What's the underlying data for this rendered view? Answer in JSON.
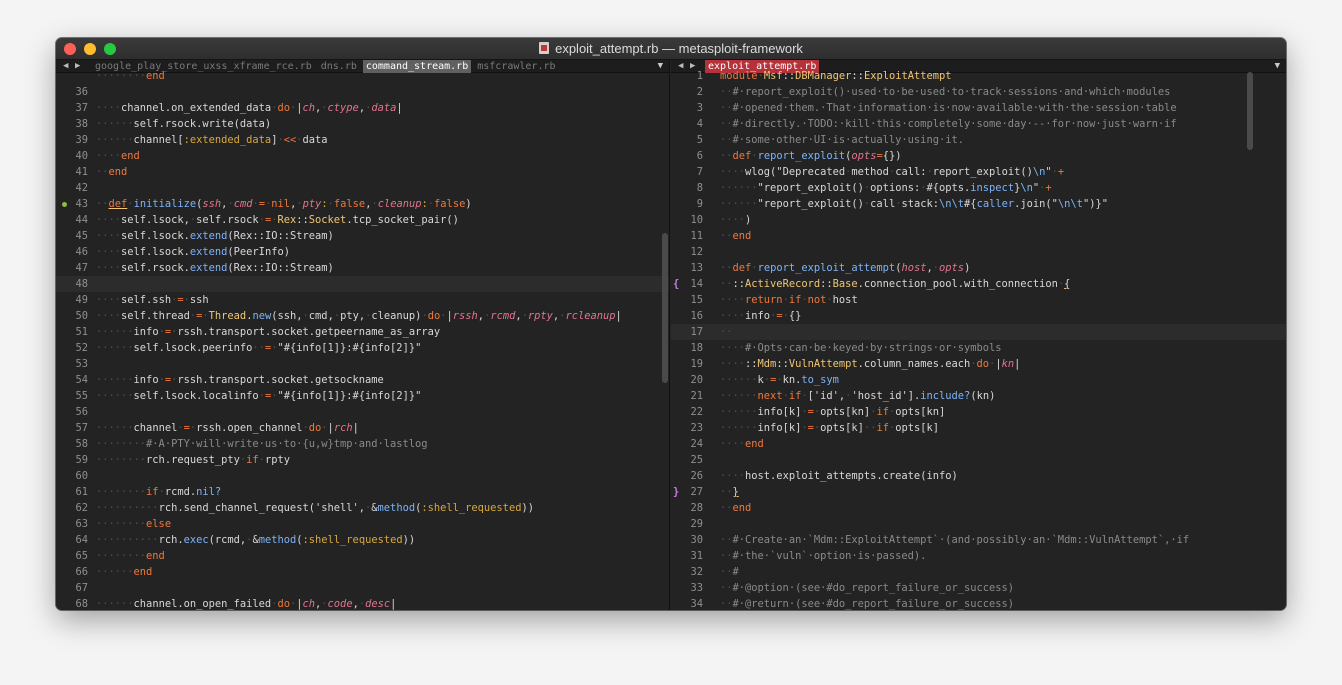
{
  "window": {
    "title": "exploit_attempt.rb — metasploit-framework"
  },
  "left_tabs": [
    {
      "label": "google_play_store_uxss_xframe_rce.rb",
      "active": false
    },
    {
      "label": "dns.rb",
      "active": false
    },
    {
      "label": "command_stream.rb",
      "active": true
    },
    {
      "label": "msfcrawler.rb",
      "active": false
    }
  ],
  "right_tabs": [
    {
      "label": "exploit_attempt.rb",
      "active": true
    }
  ],
  "nav": {
    "back": "◀",
    "forward": "▶",
    "dropdown": "▼"
  },
  "colors": {
    "keyword": "#f0783c",
    "method": "#7eb3f7",
    "argument": "#e3748f",
    "symbol": "#d8a840",
    "comment": "#8a8a8a",
    "active_tab_right": "#b5323a",
    "bracket_marker": "#c57ee0"
  },
  "left_code": [
    {
      "n": "",
      "html": "<span class='ws'>········</span><span class='kw'>end</span>"
    },
    {
      "n": "36",
      "html": ""
    },
    {
      "n": "37",
      "html": "<span class='ws'>····</span>channel.on_extended_data<span class='ws'>·</span><span class='kw'>do</span><span class='ws'>·</span>|<span class='at'>ch</span>,<span class='ws'>·</span><span class='at'>ctype</span>,<span class='ws'>·</span><span class='at'>data</span>|"
    },
    {
      "n": "38",
      "html": "<span class='ws'>······</span>self.rsock.write(data)"
    },
    {
      "n": "39",
      "html": "<span class='ws'>······</span>channel[<span class='sy'>:extended_data</span>]<span class='ws'>·</span><span class='kw'>&lt;&lt;</span><span class='ws'>·</span>data"
    },
    {
      "n": "40",
      "html": "<span class='ws'>····</span><span class='kw'>end</span>"
    },
    {
      "n": "41",
      "html": "<span class='ws'>··</span><span class='kw'>end</span>"
    },
    {
      "n": "42",
      "html": ""
    },
    {
      "n": "43",
      "dot": true,
      "html": "<span class='ws'>··</span><span class='kw und'>def</span><span class='ws'>·</span><span class='fn'>initialize</span>(<span class='at'>ssh</span>,<span class='ws'>·</span><span class='at'>cmd</span><span class='ws'>·</span><span class='kw'>=</span><span class='ws'>·</span><span class='kw'>nil</span>,<span class='ws'>·</span><span class='at'>pty</span><span class='sy'>:</span><span class='ws'>·</span><span class='kw'>false</span>,<span class='ws'>·</span><span class='at'>cleanup</span><span class='sy'>:</span><span class='ws'>·</span><span class='kw'>false</span>)"
    },
    {
      "n": "44",
      "html": "<span class='ws'>····</span>self.lsock,<span class='ws'>·</span>self.rsock<span class='ws'>·</span><span class='kw'>=</span><span class='ws'>·</span><span class='cy'>Rex</span>::<span class='cy'>Socket</span>.tcp_socket_pair()"
    },
    {
      "n": "45",
      "html": "<span class='ws'>····</span>self.lsock.<span class='mb'>extend</span>(Rex::IO::Stream)"
    },
    {
      "n": "46",
      "html": "<span class='ws'>····</span>self.lsock.<span class='mb'>extend</span>(PeerInfo)"
    },
    {
      "n": "47",
      "html": "<span class='ws'>····</span>self.rsock.<span class='mb'>extend</span>(Rex::IO::Stream)"
    },
    {
      "n": "48",
      "cur": true,
      "html": ""
    },
    {
      "n": "49",
      "html": "<span class='ws'>····</span>self.ssh<span class='ws'>·</span><span class='kw'>=</span><span class='ws'>·</span>ssh"
    },
    {
      "n": "50",
      "html": "<span class='ws'>····</span>self.thread<span class='ws'>·</span><span class='kw'>=</span><span class='ws'>·</span><span class='cy'>Thread</span>.<span class='mb'>new</span>(ssh,<span class='ws'>·</span>cmd,<span class='ws'>·</span>pty,<span class='ws'>·</span>cleanup)<span class='ws'>·</span><span class='kw'>do</span><span class='ws'>·</span>|<span class='at'>rssh</span>,<span class='ws'>·</span><span class='at'>rcmd</span>,<span class='ws'>·</span><span class='at'>rpty</span>,<span class='ws'>·</span><span class='at'>rcleanup</span>|"
    },
    {
      "n": "51",
      "html": "<span class='ws'>······</span>info<span class='ws'>·</span><span class='kw'>=</span><span class='ws'>·</span>rssh.transport.socket.getpeername_as_array"
    },
    {
      "n": "52",
      "html": "<span class='ws'>······</span>self.lsock.peerinfo<span class='ws'>··</span><span class='kw'>=</span><span class='ws'>·</span>\"#{info[1]}:#{info[2]}\""
    },
    {
      "n": "53",
      "html": ""
    },
    {
      "n": "54",
      "html": "<span class='ws'>······</span>info<span class='ws'>·</span><span class='kw'>=</span><span class='ws'>·</span>rssh.transport.socket.getsockname"
    },
    {
      "n": "55",
      "html": "<span class='ws'>······</span>self.lsock.localinfo<span class='ws'>·</span><span class='kw'>=</span><span class='ws'>·</span>\"#{info[1]}:#{info[2]}\""
    },
    {
      "n": "56",
      "html": ""
    },
    {
      "n": "57",
      "html": "<span class='ws'>······</span>channel<span class='ws'>·</span><span class='kw'>=</span><span class='ws'>·</span>rssh.open_channel<span class='ws'>·</span><span class='kw'>do</span><span class='ws'>·</span>|<span class='at'>rch</span>|"
    },
    {
      "n": "58",
      "html": "<span class='ws'>········</span><span class='cm'>#·A·PTY·will·write·us·to·{u,w}tmp·and·lastlog</span>"
    },
    {
      "n": "59",
      "html": "<span class='ws'>········</span>rch.request_pty<span class='ws'>·</span><span class='kw'>if</span><span class='ws'>·</span>rpty"
    },
    {
      "n": "60",
      "html": ""
    },
    {
      "n": "61",
      "html": "<span class='ws'>········</span><span class='kw'>if</span><span class='ws'>·</span>rcmd.<span class='mb'>nil?</span>"
    },
    {
      "n": "62",
      "html": "<span class='ws'>··········</span>rch.send_channel_request('shell',<span class='ws'>·</span>&amp;<span class='mb'>method</span>(<span class='sy'>:shell_requested</span>))"
    },
    {
      "n": "63",
      "html": "<span class='ws'>········</span><span class='kw'>else</span>"
    },
    {
      "n": "64",
      "html": "<span class='ws'>··········</span>rch.<span class='mb'>exec</span>(rcmd,<span class='ws'>·</span>&amp;<span class='mb'>method</span>(<span class='sy'>:shell_requested</span>))"
    },
    {
      "n": "65",
      "html": "<span class='ws'>········</span><span class='kw'>end</span>"
    },
    {
      "n": "66",
      "html": "<span class='ws'>······</span><span class='kw'>end</span>"
    },
    {
      "n": "67",
      "html": ""
    },
    {
      "n": "68",
      "html": "<span class='ws'>······</span>channel.on_open_failed<span class='ws'>·</span><span class='kw'>do</span><span class='ws'>·</span>|<span class='at'>ch</span>,<span class='ws'>·</span><span class='at'>code</span>,<span class='ws'>·</span><span class='at'>desc</span>|"
    }
  ],
  "right_code": [
    {
      "n": "1",
      "html": "<span class='kw'>module</span><span class='ws'>·</span><span class='cy'>Msf</span>::<span class='cy'>DBManager</span>::<span class='cy'>ExploitAttempt</span>"
    },
    {
      "n": "2",
      "html": "<span class='ws'>··</span><span class='cm'>#·report_exploit()·used·to·be·used·to·track·sessions·and·which·modules</span>"
    },
    {
      "n": "3",
      "html": "<span class='ws'>··</span><span class='cm'>#·opened·them.·That·information·is·now·available·with·the·session·table</span>"
    },
    {
      "n": "4",
      "html": "<span class='ws'>··</span><span class='cm'>#·directly.·TODO:·kill·this·completely·some·day·--·for·now·just·warn·if</span>"
    },
    {
      "n": "5",
      "html": "<span class='ws'>··</span><span class='cm'>#·some·other·UI·is·actually·using·it.</span>"
    },
    {
      "n": "6",
      "html": "<span class='ws'>··</span><span class='kw'>def</span><span class='ws'>·</span><span class='fn'>report_exploit</span>(<span class='at'>opts</span><span class='kw'>=</span>{})"
    },
    {
      "n": "7",
      "html": "<span class='ws'>····</span>wlog(\"Deprecated<span class='ws'>·</span>method<span class='ws'>·</span>call:<span class='ws'>·</span>report_exploit()<span class='es'>\\n</span>\"<span class='ws'>·</span><span class='kw'>+</span>"
    },
    {
      "n": "8",
      "html": "<span class='ws'>······</span>\"report_exploit()<span class='ws'>·</span>options:<span class='ws'>·</span>#{opts.<span class='mb'>inspect</span>}<span class='es'>\\n</span>\"<span class='ws'>·</span><span class='kw'>+</span>"
    },
    {
      "n": "9",
      "html": "<span class='ws'>······</span>\"report_exploit()<span class='ws'>·</span>call<span class='ws'>·</span>stack:<span class='es'>\\n\\t</span>#{<span class='mb'>caller</span>.join(\"<span class='es'>\\n\\t</span>\")}\""
    },
    {
      "n": "10",
      "html": "<span class='ws'>····</span>)"
    },
    {
      "n": "11",
      "html": "<span class='ws'>··</span><span class='kw'>end</span>"
    },
    {
      "n": "12",
      "html": ""
    },
    {
      "n": "13",
      "html": "<span class='ws'>··</span><span class='kw'>def</span><span class='ws'>·</span><span class='fn'>report_exploit_attempt</span>(<span class='at'>host</span>,<span class='ws'>·</span><span class='at'>opts</span>)"
    },
    {
      "n": "14",
      "gut": "{",
      "html": "<span class='ws'>··</span>::<span class='cy'>ActiveRecord</span>::<span class='cy'>Base</span>.connection_pool.with_connection<span class='ws'>·</span><span class='und'>{</span>"
    },
    {
      "n": "15",
      "html": "<span class='ws'>····</span><span class='kw'>return</span><span class='ws'>·</span><span class='kw'>if</span><span class='ws'>·</span><span class='kw'>not</span><span class='ws'>·</span>host"
    },
    {
      "n": "16",
      "html": "<span class='ws'>····</span>info<span class='ws'>·</span><span class='kw'>=</span><span class='ws'>·</span>{}"
    },
    {
      "n": "17",
      "cur": true,
      "html": "<span class='ws'>··</span>"
    },
    {
      "n": "18",
      "html": "<span class='ws'>····</span><span class='cm'>#·Opts·can·be·keyed·by·strings·or·symbols</span>"
    },
    {
      "n": "19",
      "html": "<span class='ws'>····</span>::<span class='cy'>Mdm</span>::<span class='cy'>VulnAttempt</span>.column_names.each<span class='ws'>·</span><span class='kw'>do</span><span class='ws'>·</span>|<span class='at'>kn</span>|"
    },
    {
      "n": "20",
      "html": "<span class='ws'>······</span>k<span class='ws'>·</span><span class='kw'>=</span><span class='ws'>·</span>kn.<span class='mb'>to_sym</span>"
    },
    {
      "n": "21",
      "html": "<span class='ws'>······</span><span class='kw'>next</span><span class='ws'>·</span><span class='kw'>if</span><span class='ws'>·</span>['id',<span class='ws'>·</span>'host_id'].<span class='mb'>include?</span>(kn)"
    },
    {
      "n": "22",
      "html": "<span class='ws'>······</span>info[k]<span class='ws'>·</span><span class='kw'>=</span><span class='ws'>·</span>opts[kn]<span class='ws'>·</span><span class='kw'>if</span><span class='ws'>·</span>opts[kn]"
    },
    {
      "n": "23",
      "html": "<span class='ws'>······</span>info[k]<span class='ws'>·</span><span class='kw'>=</span><span class='ws'>·</span>opts[k]<span class='ws'>··</span><span class='kw'>if</span><span class='ws'>·</span>opts[k]"
    },
    {
      "n": "24",
      "html": "<span class='ws'>····</span><span class='kw'>end</span>"
    },
    {
      "n": "25",
      "html": ""
    },
    {
      "n": "26",
      "html": "<span class='ws'>····</span>host.exploit_attempts.create(info)"
    },
    {
      "n": "27",
      "gut": "}",
      "html": "<span class='ws'>··</span><span class='und'>}</span>"
    },
    {
      "n": "28",
      "html": "<span class='ws'>··</span><span class='kw'>end</span>"
    },
    {
      "n": "29",
      "html": ""
    },
    {
      "n": "30",
      "html": "<span class='ws'>··</span><span class='cm'>#·Create·an·`Mdm::ExploitAttempt`·(and·possibly·an·`Mdm::VulnAttempt`,·if</span>"
    },
    {
      "n": "31",
      "html": "<span class='ws'>··</span><span class='cm'>#·the·`vuln`·option·is·passed).</span>"
    },
    {
      "n": "32",
      "html": "<span class='ws'>··</span><span class='cm'>#</span>"
    },
    {
      "n": "33",
      "html": "<span class='ws'>··</span><span class='cm'>#·@option·(see·#do_report_failure_or_success)</span>"
    },
    {
      "n": "34",
      "html": "<span class='ws'>··</span><span class='cm'>#·@return·(see·#do_report_failure_or_success)</span>"
    }
  ]
}
